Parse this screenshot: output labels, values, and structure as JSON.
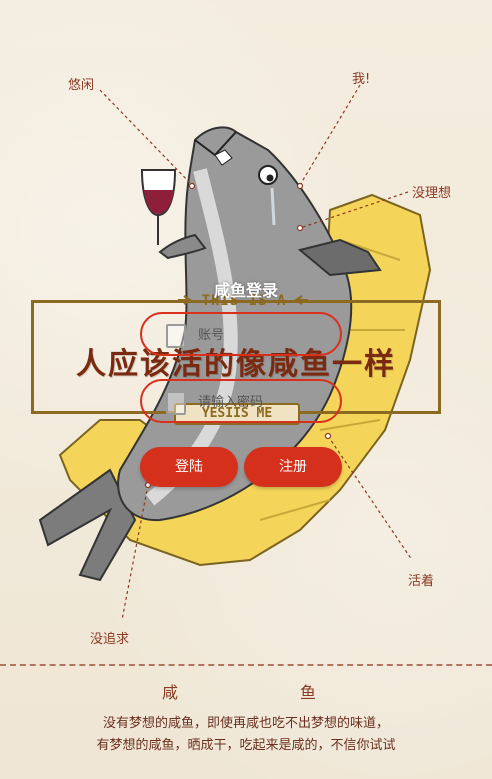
{
  "login": {
    "title": "咸鱼登录",
    "account_placeholder": "账号",
    "password_placeholder": "请输入密码",
    "login_label": "登陆",
    "register_label": "注册"
  },
  "annotations": {
    "leisure": "悠闲",
    "me": "我!",
    "ideal": "没理想",
    "alive": "活着",
    "no_pursuit": "没追求"
  },
  "banner": {
    "top": "THIS IS A",
    "main": "人应该活的像咸鱼一样",
    "bottom": "YESIIS ME"
  },
  "footer": {
    "title_left": "咸",
    "title_right": "鱼",
    "line1": "没有梦想的咸鱼，即使再咸也吃不出梦想的味道，",
    "line2": "有梦想的咸鱼，晒成干，吃起来是咸的，不信你试试"
  },
  "colors": {
    "accent_red": "#d5301c",
    "banner_gold": "#8c6a22",
    "text_brown": "#8a3a22"
  }
}
